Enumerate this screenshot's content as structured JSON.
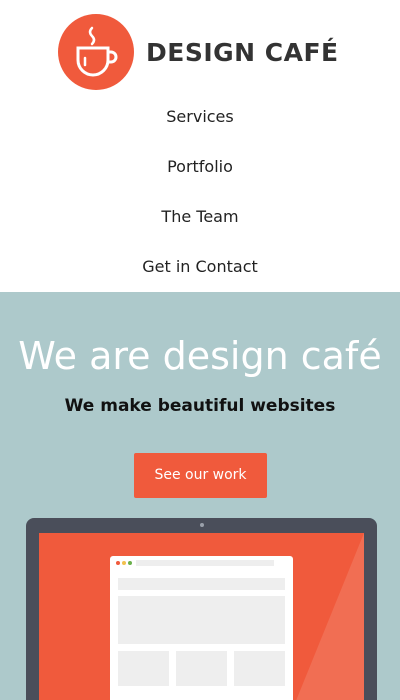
{
  "brand": {
    "name": "DESIGN CAFÉ",
    "logo_icon": "coffee-cup-icon",
    "accent_color": "#f05a3c"
  },
  "nav": {
    "items": [
      {
        "label": "Services"
      },
      {
        "label": "Portfolio"
      },
      {
        "label": "The Team"
      },
      {
        "label": "Get in Contact"
      }
    ]
  },
  "hero": {
    "title": "We are design café",
    "subtitle": "We make beautiful websites",
    "cta_label": "See our work",
    "background_color": "#adc9cb",
    "illustration": "laptop-with-browser-mockup"
  }
}
